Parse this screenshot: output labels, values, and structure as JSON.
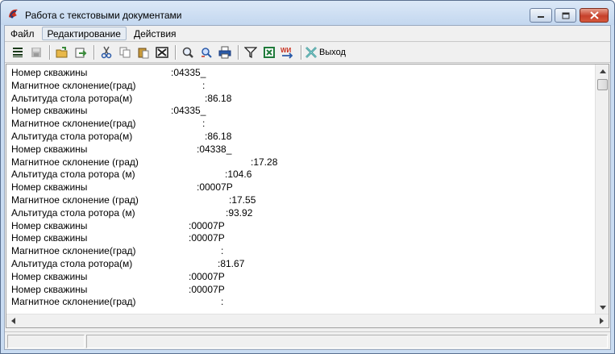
{
  "window": {
    "title": "Работа с текстовыми документами",
    "icon": "app-icon"
  },
  "menu": [
    "Файл",
    "Редактирование",
    "Действия"
  ],
  "toolbar": {
    "buttons": [
      {
        "name": "list-icon",
        "color": "#1a3a1a"
      },
      {
        "name": "save-disabled-icon",
        "color": "#9a9a9a"
      },
      {
        "name": "open-file-icon",
        "color": "#d9a12a"
      },
      {
        "name": "export-icon",
        "color": "#3a8a3a"
      },
      {
        "name": "cut-icon",
        "color": "#2a5aa8"
      },
      {
        "name": "copy-icon",
        "color": "#808080"
      },
      {
        "name": "paste-icon",
        "color": "#c89a3a"
      },
      {
        "name": "delete-icon",
        "color": "#202020"
      },
      {
        "name": "find-icon",
        "color": "#404040"
      },
      {
        "name": "find-replace-icon",
        "color": "#2a5aa8"
      },
      {
        "name": "print-icon",
        "color": "#2a5aa8"
      },
      {
        "name": "filter-icon",
        "color": "#202020"
      },
      {
        "name": "excel-icon",
        "color": "#1f7a3a"
      },
      {
        "name": "word-icon",
        "color": "#c8301e"
      },
      {
        "name": "exit-icon",
        "color": "#2a8a8a"
      }
    ],
    "exit_label": "Выход"
  },
  "document": {
    "lines": [
      {
        "label": "Номер скважины",
        "value": ":04335_"
      },
      {
        "label": "Магнитное склонение(град)",
        "value": ":"
      },
      {
        "label": "Альтитуда стола ротора(м)",
        "value": ":86.18"
      },
      {
        "label": "Номер скважины",
        "value": ":04335_"
      },
      {
        "label": "Магнитное склонение(град)",
        "value": ":"
      },
      {
        "label": "Альтитуда стола ротора(м)",
        "value": ":86.18"
      },
      {
        "label": "Номер скважины",
        "value": ":04338_"
      },
      {
        "label": "Магнитное склонение (град)",
        "value": ":17.28"
      },
      {
        "label": "Альтитуда стола ротора (м)",
        "value": ":104.6"
      },
      {
        "label": "Номер скважины",
        "value": ":00007Р"
      },
      {
        "label": "Магнитное склонение (град)",
        "value": ":17.55"
      },
      {
        "label": "Альтитуда стола ротора (м)",
        "value": ":93.92"
      },
      {
        "label": "Номер скважины",
        "value": ":00007Р"
      },
      {
        "label": "Номер скважины",
        "value": ":00007Р"
      },
      {
        "label": "Магнитное склонение(град)",
        "value": ":"
      },
      {
        "label": "Альтитуда стола ротора(м)",
        "value": ":81.67"
      },
      {
        "label": "Номер скважины",
        "value": ":00007Р"
      },
      {
        "label": "Номер скважины",
        "value": ":00007Р"
      },
      {
        "label": "Магнитное склонение(град)",
        "value": ":"
      }
    ]
  }
}
